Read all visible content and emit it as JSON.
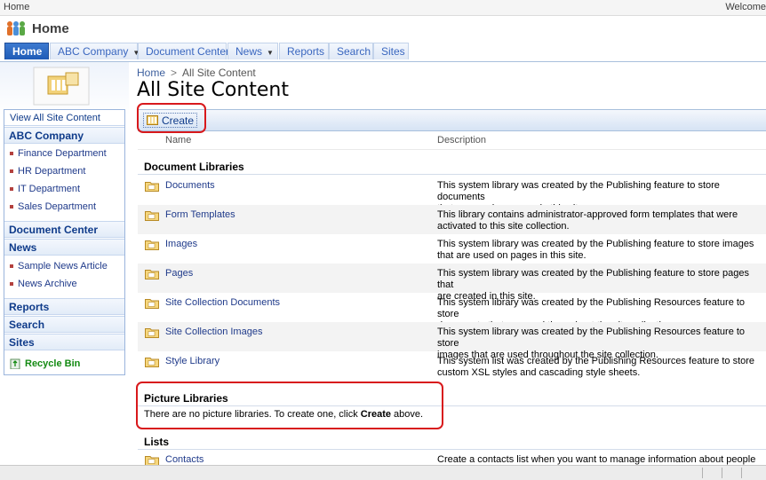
{
  "topbar": {
    "breadcrumb": "Home",
    "welcome": "Welcome"
  },
  "site": {
    "title": "Home"
  },
  "nav": {
    "tabs": [
      {
        "label": "Home"
      },
      {
        "label": "ABC Company"
      },
      {
        "label": "Document Center"
      },
      {
        "label": "News"
      },
      {
        "label": "Reports"
      },
      {
        "label": "Search"
      },
      {
        "label": "Sites"
      }
    ]
  },
  "quicklaunch": {
    "view_all": "View All Site Content",
    "abc_company": "ABC Company",
    "abc_items": [
      "Finance Department",
      "HR Department",
      "IT Department",
      "Sales Department"
    ],
    "document_center": "Document Center",
    "news": "News",
    "news_items": [
      "Sample News Article",
      "News Archive"
    ],
    "reports": "Reports",
    "search": "Search",
    "sites": "Sites",
    "recycle_bin": "Recycle Bin"
  },
  "page": {
    "breadcrumb_home": "Home",
    "breadcrumb_sep": ">",
    "breadcrumb_current": "All Site Content",
    "title": "All Site Content"
  },
  "toolbar": {
    "create_label": "Create"
  },
  "columns": {
    "name": "Name",
    "description": "Description"
  },
  "sections": {
    "document_libraries": "Document Libraries",
    "picture_libraries": "Picture Libraries",
    "lists": "Lists"
  },
  "doc_libraries": [
    {
      "name": "Documents",
      "desc1": "This system library was created by the Publishing feature to store documents",
      "desc2": "that are used on pages in this site."
    },
    {
      "name": "Form Templates",
      "desc1": "This library contains administrator-approved form templates that were",
      "desc2": "activated to this site collection."
    },
    {
      "name": "Images",
      "desc1": "This system library was created by the Publishing feature to store images",
      "desc2": "that are used on pages in this site."
    },
    {
      "name": "Pages",
      "desc1": "This system library was created by the Publishing feature to store pages that",
      "desc2": "are created in this site."
    },
    {
      "name": "Site Collection Documents",
      "desc1": "This system library was created by the Publishing Resources feature to store",
      "desc2": "documents that are used throughout the site collection."
    },
    {
      "name": "Site Collection Images",
      "desc1": "This system library was created by the Publishing Resources feature to store",
      "desc2": "images that are used throughout the site collection."
    },
    {
      "name": "Style Library",
      "desc1": "This system list was created by the Publishing Resources feature to store",
      "desc2": "custom XSL styles and cascading style sheets."
    }
  ],
  "picture_libraries_empty": {
    "before": "There are no picture libraries. To create one, click ",
    "bold": "Create",
    "after": " above."
  },
  "lists": [
    {
      "name": "Contacts",
      "desc1": "Create a contacts list when you want to manage information about people",
      "desc2": ""
    }
  ],
  "colors": {
    "link": "#1f3a8a",
    "highlight": "#d8191c",
    "nav_selected": "#1f5cb7"
  }
}
